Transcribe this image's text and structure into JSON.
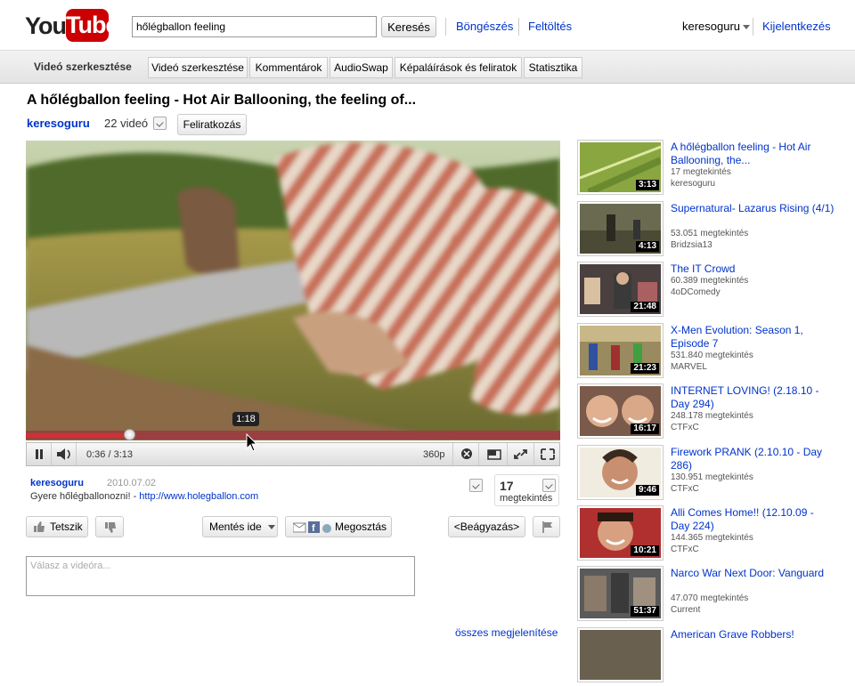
{
  "header": {
    "logo_you": "You",
    "logo_tube": "Tube",
    "search_value": "hőlégballon feeling",
    "search_button": "Keresés",
    "browse": "Böngészés",
    "upload": "Feltöltés",
    "username": "keresoguru",
    "logout": "Kijelentkezés"
  },
  "editbar": {
    "title": "Videó szerkesztése",
    "buttons": [
      "Videó szerkesztése",
      "Kommentárok",
      "AudioSwap",
      "Képaláírások és feliratok",
      "Statisztika"
    ]
  },
  "video": {
    "title": "A hőlégballon feeling - Hot Air Ballooning, the feeling of...",
    "channel": "keresoguru",
    "video_count": "22 videó",
    "subscribe": "Feliratkozás"
  },
  "player": {
    "tooltip_time": "1:18",
    "time_display": "0:36 / 3:13",
    "quality": "360p",
    "progress_fraction": 0.194,
    "hover_fraction": 0.41
  },
  "info": {
    "author": "keresoguru",
    "date": "2010.07.02",
    "desc_text": "Gyere hőlégballonozni! - ",
    "desc_link": "http://www.holegballon.com",
    "views": "17",
    "views_label": "megtekintés"
  },
  "actions": {
    "like": "Tetszik",
    "save": "Mentés ide",
    "share": "Megosztás",
    "embed": "<Beágyazás>"
  },
  "comment": {
    "placeholder": "Válasz a videóra..."
  },
  "show_all": "összes megjelenítése",
  "related": [
    {
      "title": "A hőlégballon feeling - Hot Air Ballooning, the...",
      "views": "17 megtekintés",
      "channel": "keresoguru",
      "duration": "3:13"
    },
    {
      "title": "Supernatural- Lazarus Rising (4/1)",
      "views": "53.051 megtekintés",
      "channel": "Bridzsia13",
      "duration": "4:13"
    },
    {
      "title": "The IT Crowd",
      "views": "60.389 megtekintés",
      "channel": "4oDComedy",
      "duration": "21:48"
    },
    {
      "title": "X-Men Evolution: Season 1, Episode 7",
      "views": "531.840 megtekintés",
      "channel": "MARVEL",
      "duration": "21:23"
    },
    {
      "title": "INTERNET LOVING! (2.18.10 - Day 294)",
      "views": "248.178 megtekintés",
      "channel": "CTFxC",
      "duration": "16:17"
    },
    {
      "title": "Firework PRANK (2.10.10 - Day 286)",
      "views": "130.951 megtekintés",
      "channel": "CTFxC",
      "duration": "9:46"
    },
    {
      "title": "Alli Comes Home!! (12.10.09 - Day 224)",
      "views": "144.365 megtekintés",
      "channel": "CTFxC",
      "duration": "10:21"
    },
    {
      "title": "Narco War Next Door: Vanguard",
      "views": "47.070 megtekintés",
      "channel": "Current",
      "duration": "51:37"
    },
    {
      "title": "American Grave Robbers!",
      "views": "",
      "channel": "",
      "duration": ""
    }
  ]
}
